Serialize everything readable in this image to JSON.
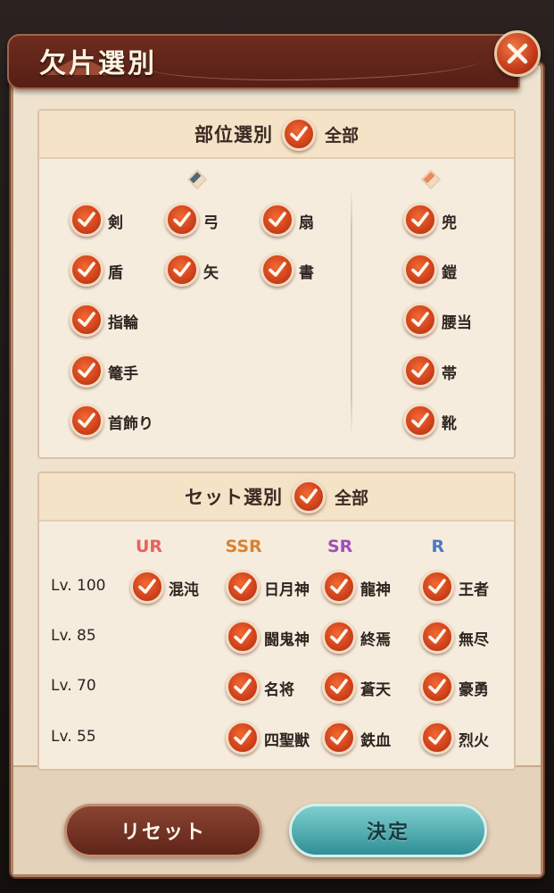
{
  "dialog": {
    "title": "欠片選別",
    "close_icon": "close-x-icon"
  },
  "part_section": {
    "title": "部位選別",
    "all_label": "全部",
    "all_checked": true,
    "weapons": [
      {
        "label": "剣",
        "checked": true
      },
      {
        "label": "弓",
        "checked": true
      },
      {
        "label": "扇",
        "checked": true
      },
      {
        "label": "盾",
        "checked": true
      },
      {
        "label": "矢",
        "checked": true
      },
      {
        "label": "書",
        "checked": true
      },
      {
        "label": "指輪",
        "checked": true
      },
      {
        "label": "篭手",
        "checked": true
      },
      {
        "label": "首飾り",
        "checked": true
      }
    ],
    "armor": [
      {
        "label": "兜",
        "checked": true
      },
      {
        "label": "鎧",
        "checked": true
      },
      {
        "label": "腰当",
        "checked": true
      },
      {
        "label": "帯",
        "checked": true
      },
      {
        "label": "靴",
        "checked": true
      }
    ]
  },
  "set_section": {
    "title": "セット選別",
    "all_label": "全部",
    "all_checked": true,
    "rarities": [
      {
        "label": "UR",
        "color": "#e8625a"
      },
      {
        "label": "SSR",
        "color": "#d9822f"
      },
      {
        "label": "SR",
        "color": "#a04fb8"
      },
      {
        "label": "R",
        "color": "#4a78c4"
      }
    ],
    "rows": [
      {
        "level": "Lv. 100",
        "ur": "混沌",
        "ssr": "日月神",
        "sr": "龍神",
        "r": "王者"
      },
      {
        "level": "Lv. 85",
        "ur": "",
        "ssr": "闘鬼神",
        "sr": "終焉",
        "r": "無尽"
      },
      {
        "level": "Lv. 70",
        "ur": "",
        "ssr": "名将",
        "sr": "蒼天",
        "r": "豪勇"
      },
      {
        "level": "Lv. 55",
        "ur": "",
        "ssr": "四聖獣",
        "sr": "鉄血",
        "r": "烈火"
      }
    ]
  },
  "buttons": {
    "reset": "リセット",
    "confirm": "決定"
  },
  "colors": {
    "checkbox": "#d3441d",
    "title_bar": "#6e2c1f",
    "confirm_button": "#2f8f96",
    "reset_button": "#6f3022"
  }
}
